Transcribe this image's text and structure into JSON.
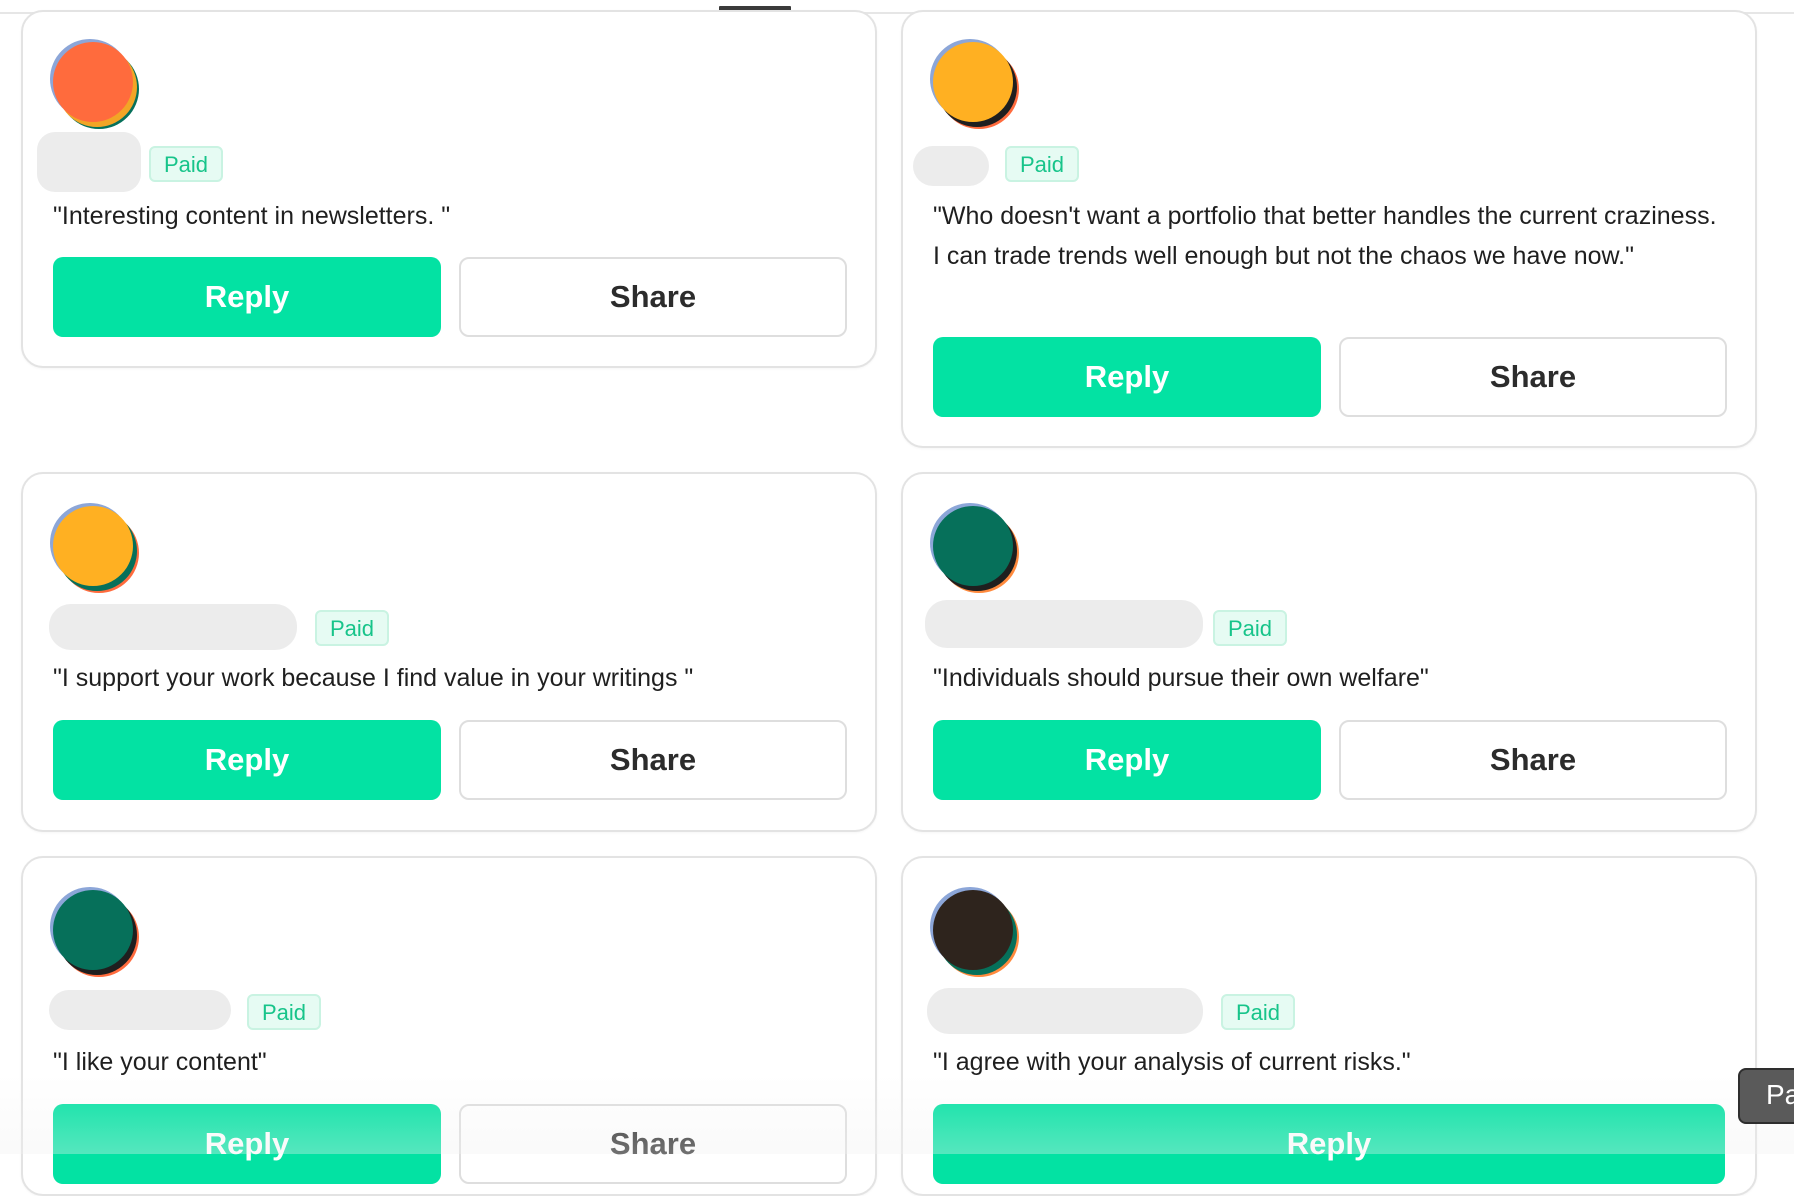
{
  "paid_label": "Paid",
  "reply_label": "Reply",
  "share_label": "Share",
  "floating_button_label": "Pa",
  "comments": [
    {
      "quote": "\"Interesting content in newsletters. \"",
      "avatar_color": "#ff6b3d"
    },
    {
      "quote": "\"Who doesn't want a portfolio that better handles the current craziness. I can trade trends well enough but not the chaos we have now.\"",
      "avatar_color": "#ffb022"
    },
    {
      "quote": "\"I support your work because I find value in your writings \"",
      "avatar_color": "#ffb022"
    },
    {
      "quote": "\"Individuals should pursue their own welfare\"",
      "avatar_color": "#06705a"
    },
    {
      "quote": "\"I like your content\"",
      "avatar_color": "#06705a"
    },
    {
      "quote": "\"I agree with your analysis of current risks.\"",
      "avatar_color": "#2e241d"
    }
  ],
  "colors": {
    "accent": "#03e2a3",
    "paid_badge_text": "#17c48a",
    "paid_badge_bg": "#e6fbf3"
  }
}
